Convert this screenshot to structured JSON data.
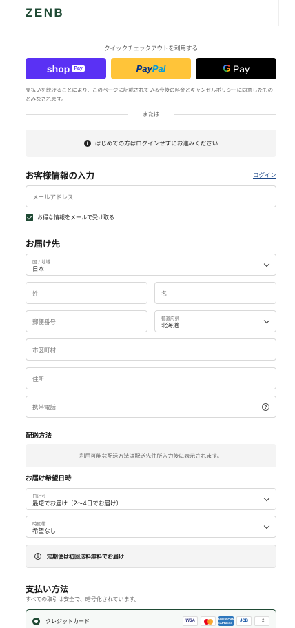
{
  "brand": {
    "logo": "ZENB"
  },
  "express": {
    "label": "クイックチェックアウトを利用する",
    "shop_pay": {
      "text": "shop",
      "badge": "Pay"
    },
    "paypal": {
      "pay": "Pay",
      "pal": "Pal"
    },
    "gpay": {
      "g": "G",
      "text": "Pay"
    },
    "policy": "支払いを続けることにより、このページに記載されている今後の料金とキャンセルポリシーに同意したものとみなされます。"
  },
  "divider": "または",
  "notice": {
    "icon": "info-icon",
    "text": "はじめての方はログインせずにお進みください"
  },
  "customer": {
    "title": "お客様情報の入力",
    "login_link": "ログイン",
    "email_placeholder": "メールアドレス",
    "newsletter_label": "お得な情報をメールで受け取る",
    "newsletter_checked": true
  },
  "delivery": {
    "title": "お届け先",
    "country_label": "国 / 地域",
    "country_value": "日本",
    "last_name_placeholder": "姓",
    "first_name_placeholder": "名",
    "postal_placeholder": "郵便番号",
    "prefecture_label": "都道府県",
    "prefecture_value": "北海道",
    "city_placeholder": "市区町村",
    "address_placeholder": "住所",
    "phone_placeholder": "携帯電話",
    "help_icon": "?"
  },
  "shipping": {
    "title": "配送方法",
    "message": "利用可能な配送方法は配送先住所入力後に表示されます。"
  },
  "schedule": {
    "title": "お届け希望日時",
    "date_label": "日にち",
    "date_value": "最短でお届け（2〜4日でお届け）",
    "time_label": "時間帯",
    "time_value": "希望なし",
    "notice": "定期便は初回送料無料でお届け"
  },
  "payment": {
    "title": "支払い方法",
    "subtitle": "すべての取引は安全で、暗号化されています。",
    "credit_card_label": "クレジットカード",
    "cards": {
      "visa": "VISA",
      "amex": "AMERICAN EXPRESS",
      "jcb": "JCB",
      "more": "+2"
    }
  },
  "colors": {
    "brand_green": "#1f4a34",
    "shop_pay": "#5a31f4",
    "paypal": "#ffc439"
  }
}
